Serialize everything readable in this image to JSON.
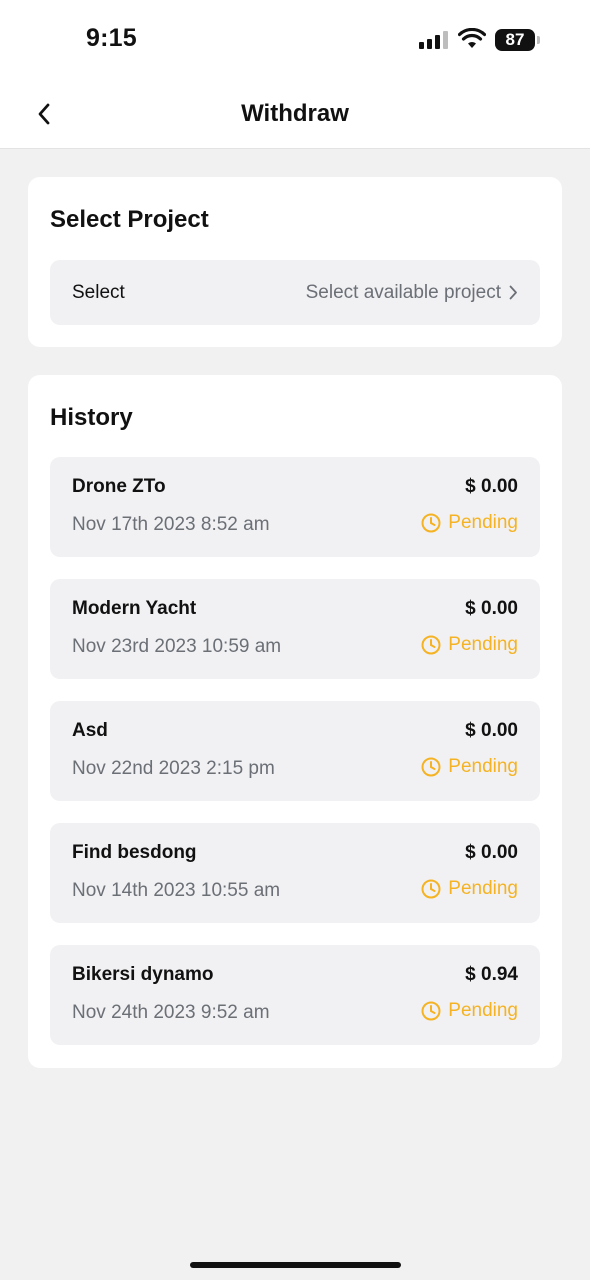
{
  "status_bar": {
    "time": "9:15",
    "battery": "87"
  },
  "nav": {
    "title": "Withdraw"
  },
  "select_project": {
    "title": "Select Project",
    "label": "Select",
    "value": "Select available project"
  },
  "history": {
    "title": "History",
    "items": [
      {
        "name": "Drone ZTo",
        "amount": "$ 0.00",
        "date": "Nov 17th 2023 8:52 am",
        "status": "Pending"
      },
      {
        "name": "Modern Yacht",
        "amount": "$ 0.00",
        "date": "Nov 23rd 2023 10:59 am",
        "status": "Pending"
      },
      {
        "name": "Asd",
        "amount": "$ 0.00",
        "date": "Nov 22nd 2023 2:15 pm",
        "status": "Pending"
      },
      {
        "name": "Find besdong",
        "amount": "$ 0.00",
        "date": "Nov 14th 2023 10:55 am",
        "status": "Pending"
      },
      {
        "name": "Bikersi dynamo",
        "amount": "$ 0.94",
        "date": "Nov 24th 2023 9:52 am",
        "status": "Pending"
      }
    ]
  },
  "colors": {
    "pending": "#f5b323",
    "background": "#f1f1f2",
    "muted_text": "#6b6f76"
  }
}
